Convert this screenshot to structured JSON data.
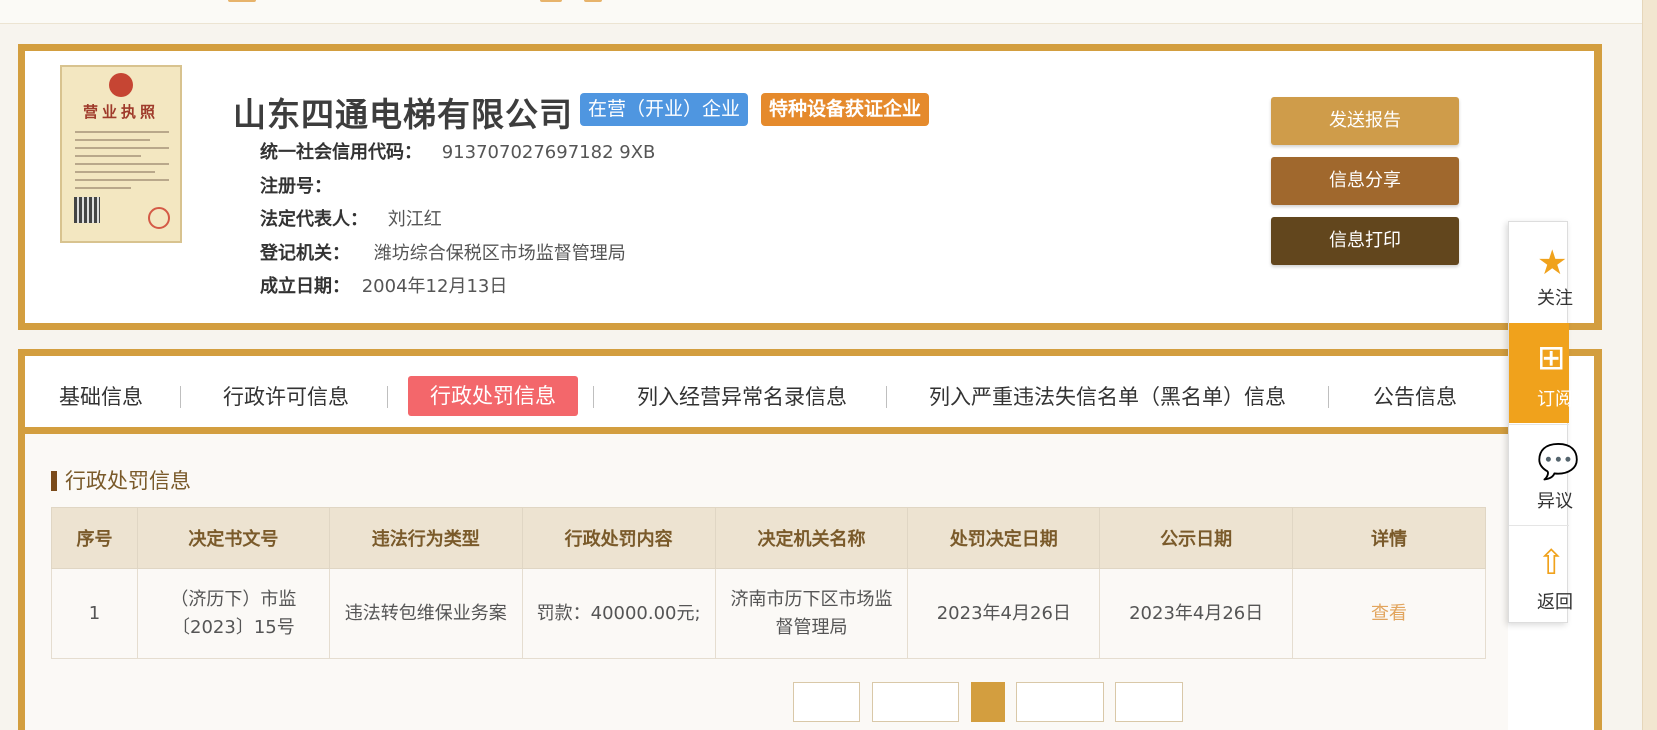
{
  "company": {
    "name": "山东四通电梯有限公司",
    "tags": [
      "在营（开业）企业",
      "特种设备获证企业"
    ],
    "info": [
      {
        "label": "统一社会信用代码：",
        "value": "913707027697182 9XB"
      },
      {
        "label": "注册号：",
        "value": ""
      },
      {
        "label": "法定代表人：",
        "value": "刘江红"
      },
      {
        "label": "登记机关：",
        "value": "潍坊综合保税区市场监督管理局"
      },
      {
        "label": "成立日期：",
        "value": "2004年12月13日"
      }
    ]
  },
  "license": {
    "title": "营业执照"
  },
  "buttons": {
    "send_report": "发送报告",
    "share": "信息分享",
    "print": "信息打印"
  },
  "tabs": [
    "基础信息",
    "行政许可信息",
    "行政处罚信息",
    "列入经营异常名录信息",
    "列入严重违法失信名单（黑名单）信息",
    "公告信息"
  ],
  "active_tab": "行政处罚信息",
  "section": {
    "title": "行政处罚信息",
    "columns": [
      "序号",
      "决定书文号",
      "违法行为类型",
      "行政处罚内容",
      "决定机关名称",
      "处罚决定日期",
      "公示日期",
      "详情"
    ],
    "rows": [
      [
        "1",
        "（济历下）市监〔2023〕15号",
        "违法转包维保业务案",
        "罚款：40000.00元;",
        "济南市历下区市场监督管理局",
        "2023年4月26日",
        "2023年4月26日",
        "查看"
      ]
    ]
  },
  "sidebar": {
    "follow": "关注",
    "subscribe": "订阅",
    "objection": "异议",
    "back_top": "返回"
  },
  "colors": {
    "gold": "#d39e3f",
    "active_tab": "#f3676b",
    "sidebar_accent": "#f0a21c",
    "tag_blue": "#4f96e0",
    "tag_orange": "#e58a2c"
  }
}
